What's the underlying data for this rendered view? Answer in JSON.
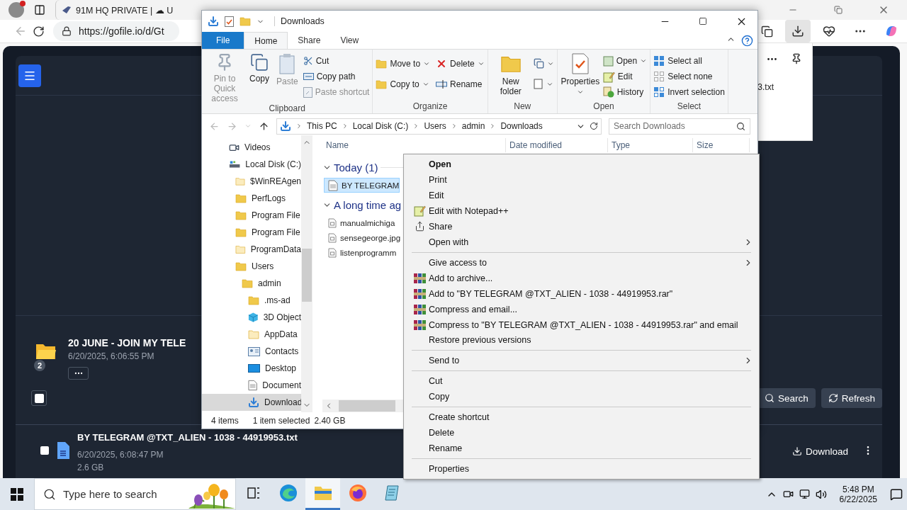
{
  "browser": {
    "tab": {
      "title": "91M HQ PRIVATE | ☁ U",
      "selected": false
    },
    "address": "https://gofile.io/d/Gt",
    "downloads_panel_open": true,
    "downloads_panel": {
      "file": "3.txt"
    }
  },
  "page": {
    "folder": {
      "title": "20 JUNE - JOIN MY TELE",
      "date": "6/20/2025, 6:06:55 PM",
      "badge": "2"
    },
    "select_all": {
      "checked": false
    },
    "buttons": [
      {
        "label": "Search",
        "kind": "search"
      },
      {
        "label": "Refresh",
        "kind": "refresh"
      }
    ],
    "file": {
      "name": "BY TELEGRAM @TXT_ALIEN - 1038 - 44919953.txt",
      "date": "6/20/2025, 6:08:47 PM",
      "size": "2.6 GB",
      "checked": false,
      "action": "Download"
    }
  },
  "explorer": {
    "title": "Downloads",
    "ribbon_tabs": [
      {
        "label": "File",
        "kind": "file",
        "selected": false
      },
      {
        "label": "Home",
        "kind": "tab",
        "selected": true
      },
      {
        "label": "Share",
        "kind": "tab",
        "selected": false
      },
      {
        "label": "View",
        "kind": "tab",
        "selected": false
      }
    ],
    "ribbon_groups": [
      {
        "name": "Clipboard",
        "buttons": [
          {
            "label": "Pin to Quick access",
            "kind": "large",
            "disabled": true,
            "menu": false
          },
          {
            "label": "Copy",
            "kind": "large",
            "disabled": false,
            "menu": false
          },
          {
            "label": "Paste",
            "kind": "large",
            "disabled": true,
            "menu": false
          },
          {
            "label": "Cut",
            "kind": "small",
            "disabled": false,
            "menu": false
          },
          {
            "label": "Copy path",
            "kind": "small",
            "disabled": false,
            "menu": false
          },
          {
            "label": "Paste shortcut",
            "kind": "small",
            "disabled": true,
            "menu": false
          }
        ]
      },
      {
        "name": "Organize",
        "buttons": [
          {
            "label": "Move to",
            "kind": "small",
            "disabled": false,
            "menu": true
          },
          {
            "label": "Copy to",
            "kind": "small",
            "disabled": false,
            "menu": true
          },
          {
            "label": "Delete",
            "kind": "small",
            "disabled": false,
            "menu": true
          },
          {
            "label": "Rename",
            "kind": "small",
            "disabled": false,
            "menu": false
          }
        ]
      },
      {
        "name": "New",
        "buttons": [
          {
            "label": "New folder",
            "kind": "large",
            "disabled": false,
            "menu": false
          },
          {
            "kind": "small",
            "disabled": false,
            "menu": true
          },
          {
            "kind": "small",
            "disabled": false,
            "menu": true
          }
        ]
      },
      {
        "name": "Open",
        "buttons": [
          {
            "label": "Properties",
            "kind": "large",
            "disabled": false,
            "menu": true
          },
          {
            "label": "Open",
            "kind": "small",
            "disabled": false,
            "menu": true
          },
          {
            "label": "Edit",
            "kind": "small",
            "disabled": false,
            "menu": false
          },
          {
            "label": "History",
            "kind": "small",
            "disabled": false,
            "menu": false
          }
        ]
      },
      {
        "name": "Select",
        "buttons": [
          {
            "label": "Select all",
            "kind": "small",
            "disabled": false,
            "menu": false
          },
          {
            "label": "Select none",
            "kind": "small",
            "disabled": false,
            "menu": false
          },
          {
            "label": "Invert selection",
            "kind": "small",
            "disabled": false,
            "menu": false
          }
        ]
      }
    ],
    "breadcrumbs": [
      "This PC",
      "Local Disk (C:)",
      "Users",
      "admin",
      "Downloads"
    ],
    "search_placeholder": "Search Downloads",
    "tree": [
      {
        "label": "Videos",
        "kind": "videos",
        "selected": false
      },
      {
        "label": "Local Disk (C:)",
        "kind": "drive",
        "selected": false,
        "children": [
          {
            "label": "$WinREAgen",
            "kind": "folder",
            "hidden": true,
            "selected": false
          },
          {
            "label": "PerfLogs",
            "kind": "folder",
            "hidden": false,
            "selected": false
          },
          {
            "label": "Program File",
            "kind": "folder",
            "hidden": false,
            "selected": false
          },
          {
            "label": "Program File",
            "kind": "folder",
            "hidden": false,
            "selected": false
          },
          {
            "label": "ProgramData",
            "kind": "folder",
            "hidden": true,
            "selected": false
          },
          {
            "label": "Users",
            "kind": "folder",
            "hidden": false,
            "selected": false,
            "children": [
              {
                "label": "admin",
                "kind": "folder",
                "hidden": false,
                "selected": false,
                "children": [
                  {
                    "label": ".ms-ad",
                    "kind": "folder",
                    "hidden": false,
                    "selected": false
                  },
                  {
                    "label": "3D Object",
                    "kind": "cube",
                    "selected": false
                  },
                  {
                    "label": "AppData",
                    "kind": "folder",
                    "hidden": true,
                    "selected": false
                  },
                  {
                    "label": "Contacts",
                    "kind": "contacts",
                    "selected": false
                  },
                  {
                    "label": "Desktop",
                    "kind": "desktop",
                    "selected": false
                  },
                  {
                    "label": "Document",
                    "kind": "documents",
                    "selected": false
                  },
                  {
                    "label": "Download",
                    "kind": "downloads",
                    "selected": true
                  }
                ]
              }
            ]
          }
        ]
      }
    ],
    "columns": [
      "Name",
      "Date modified",
      "Type",
      "Size"
    ],
    "groups": [
      {
        "label": "Today (1)",
        "expanded": true,
        "files": [
          {
            "name": "BY TELEGRAM",
            "kind": "text",
            "selected": true
          }
        ]
      },
      {
        "label": "A long time ag",
        "expanded": true,
        "files": [
          {
            "name": "manualmichiga",
            "kind": "file",
            "selected": false
          },
          {
            "name": "sensegeorge.jpg",
            "kind": "file",
            "selected": false
          },
          {
            "name": "listenprogramm",
            "kind": "file",
            "selected": false
          }
        ]
      }
    ],
    "status": {
      "items": "4 items",
      "selection": "1 item selected",
      "size": "2.40 GB"
    }
  },
  "context_menu": {
    "groups": [
      [
        {
          "label": "Open",
          "kind": "plain",
          "default": true,
          "submenu": false
        },
        {
          "label": "Print",
          "kind": "plain",
          "default": false,
          "submenu": false
        },
        {
          "label": "Edit",
          "kind": "plain",
          "default": false,
          "submenu": false
        },
        {
          "label": "Edit with Notepad++",
          "kind": "notepad",
          "default": false,
          "submenu": false
        },
        {
          "label": "Share",
          "kind": "share",
          "default": false,
          "submenu": false
        },
        {
          "label": "Open with",
          "kind": "plain",
          "default": false,
          "submenu": true
        }
      ],
      [
        {
          "label": "Give access to",
          "kind": "plain",
          "default": false,
          "submenu": true
        },
        {
          "label": "Add to archive...",
          "kind": "archive",
          "default": false,
          "submenu": false
        },
        {
          "label": "Add to \"BY TELEGRAM @TXT_ALIEN - 1038 - 44919953.rar\"",
          "kind": "archive",
          "default": false,
          "submenu": false
        },
        {
          "label": "Compress and email...",
          "kind": "archive",
          "default": false,
          "submenu": false
        },
        {
          "label": "Compress to \"BY TELEGRAM @TXT_ALIEN - 1038 - 44919953.rar\" and email",
          "kind": "archive",
          "default": false,
          "submenu": false
        },
        {
          "label": "Restore previous versions",
          "kind": "plain",
          "default": false,
          "submenu": false
        }
      ],
      [
        {
          "label": "Send to",
          "kind": "plain",
          "default": false,
          "submenu": true
        }
      ],
      [
        {
          "label": "Cut",
          "kind": "plain",
          "default": false,
          "submenu": false
        },
        {
          "label": "Copy",
          "kind": "plain",
          "default": false,
          "submenu": false
        }
      ],
      [
        {
          "label": "Create shortcut",
          "kind": "plain",
          "default": false,
          "submenu": false
        },
        {
          "label": "Delete",
          "kind": "plain",
          "default": false,
          "submenu": false
        },
        {
          "label": "Rename",
          "kind": "plain",
          "default": false,
          "submenu": false
        }
      ],
      [
        {
          "label": "Properties",
          "kind": "plain",
          "default": false,
          "submenu": false
        }
      ]
    ]
  },
  "taskbar": {
    "search_placeholder": "Type here to search",
    "apps": [
      {
        "kind": "edge",
        "selected": false
      },
      {
        "kind": "explorer",
        "selected": true
      },
      {
        "kind": "firefox",
        "selected": false
      },
      {
        "kind": "notepad",
        "selected": false
      }
    ],
    "time": "5:48 PM",
    "date": "6/22/2025"
  }
}
